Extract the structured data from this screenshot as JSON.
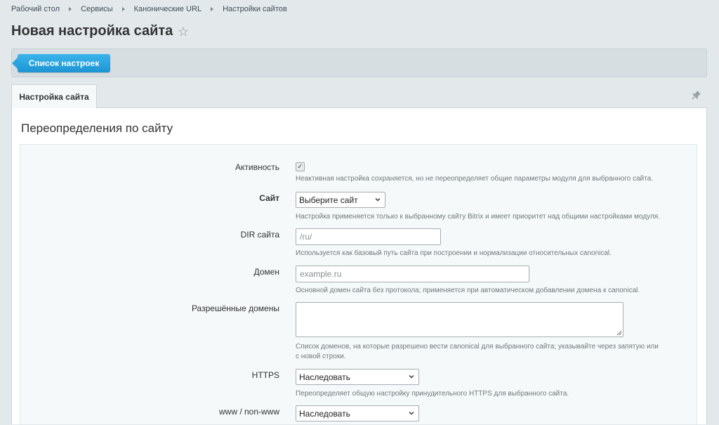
{
  "breadcrumb": [
    "Рабочий стол",
    "Сервисы",
    "Канонические URL",
    "Настройки сайтов"
  ],
  "page": {
    "title": "Новая настройка сайта"
  },
  "toolbar": {
    "list_button": "Список настроек"
  },
  "tabs": {
    "active": "Настройка сайта"
  },
  "section": {
    "title": "Переопределения по сайту"
  },
  "form": {
    "active": {
      "label": "Активность",
      "checked": true,
      "hint": "Неактивная настройка сохраняется, но не переопределяет общие параметры модуля для выбранного сайта."
    },
    "site": {
      "label": "Сайт",
      "value": "Выберите сайт",
      "hint": "Настройка применяется только к выбранному сайту Bitrix и имеет приоритет над общими настройками модуля."
    },
    "dir": {
      "label": "DIR сайта",
      "placeholder": "/ru/",
      "hint": "Используется как базовый путь сайта при построении и нормализации относительных canonical."
    },
    "domain": {
      "label": "Домен",
      "placeholder": "example.ru",
      "hint": "Основной домен сайта без протокола; применяется при автоматическом добавлении домена к canonical."
    },
    "allowed_domains": {
      "label": "Разрешённые домены",
      "hint_line1": "Список доменов, на которые разрешено вести canonical для выбранного сайта; указывайте через запятую или",
      "hint_line2": "с новой строки."
    },
    "https": {
      "label": "HTTPS",
      "value": "Наследовать",
      "hint": "Переопределяет общую настройку принудительного HTTPS для выбранного сайта."
    },
    "www": {
      "label": "www / non-www",
      "value": "Наследовать"
    }
  },
  "colors": {
    "accent": "#2aa4e0",
    "background": "#e3e8eb"
  }
}
